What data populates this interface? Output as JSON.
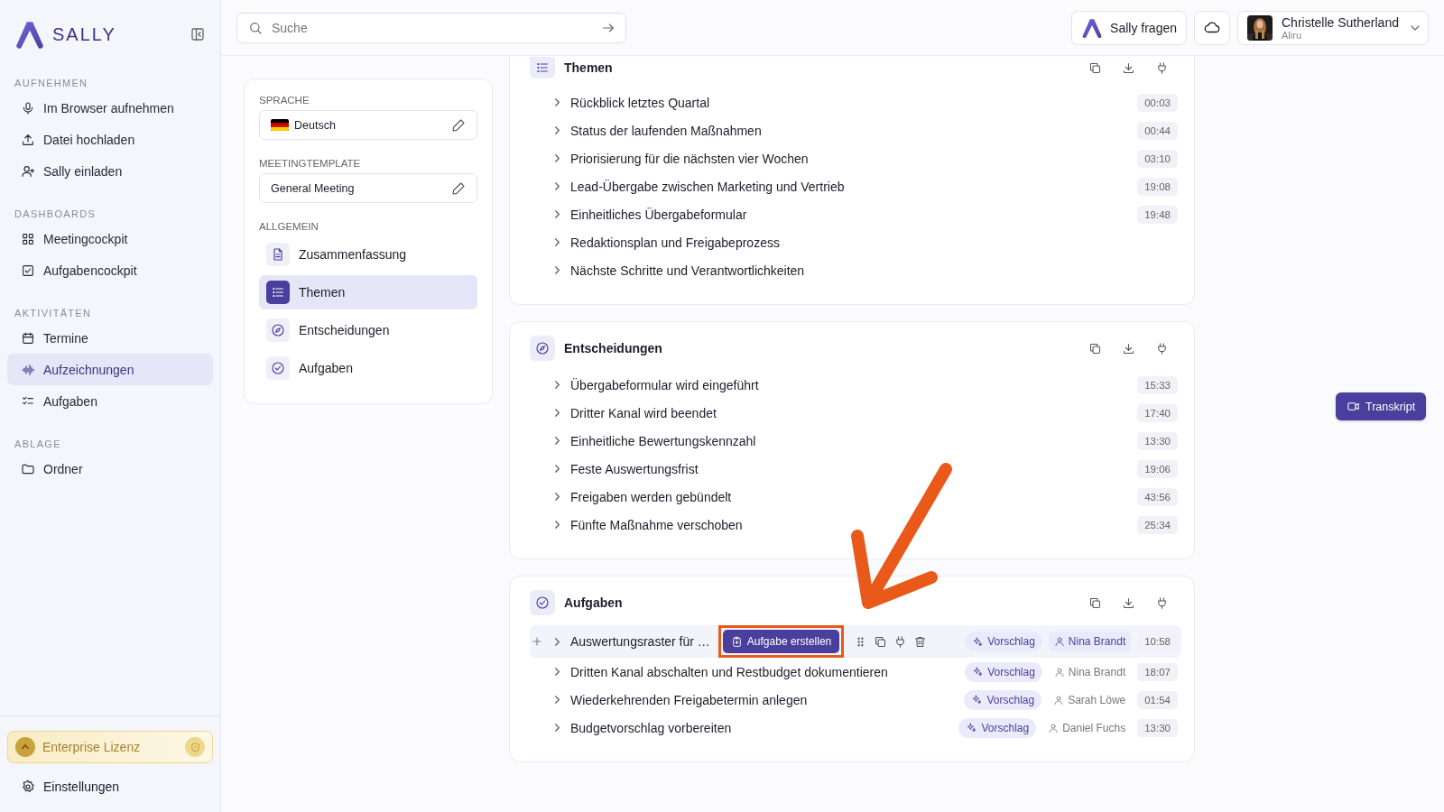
{
  "sidebar": {
    "brand": "SALLY",
    "sections": [
      {
        "title": "AUFNEHMEN",
        "items": [
          {
            "label": "Im Browser aufnehmen",
            "selected": false
          },
          {
            "label": "Datei hochladen",
            "selected": false
          },
          {
            "label": "Sally einladen",
            "selected": false
          }
        ]
      },
      {
        "title": "DASHBOARDS",
        "items": [
          {
            "label": "Meetingcockpit",
            "selected": false
          },
          {
            "label": "Aufgabencockpit",
            "selected": false
          }
        ]
      },
      {
        "title": "AKTIVITÄTEN",
        "items": [
          {
            "label": "Termine",
            "selected": false
          },
          {
            "label": "Aufzeichnungen",
            "selected": true
          },
          {
            "label": "Aufgaben",
            "selected": false
          }
        ]
      },
      {
        "title": "ABLAGE",
        "items": [
          {
            "label": "Ordner",
            "selected": false
          }
        ]
      }
    ],
    "license": "Enterprise Lizenz",
    "settings": "Einstellungen"
  },
  "topbar": {
    "search": {
      "placeholder": "Suche"
    },
    "ask_button": "Sally fragen",
    "user": {
      "name": "Christelle Sutherland",
      "org": "Aliru"
    }
  },
  "panel": {
    "language": {
      "label": "SPRACHE",
      "value": "Deutsch"
    },
    "template": {
      "label": "MEETINGTEMPLATE",
      "value": "General Meeting"
    },
    "general_label": "ALLGEMEIN",
    "items": [
      {
        "label": "Zusammenfassung",
        "selected": false
      },
      {
        "label": "Themen",
        "selected": true
      },
      {
        "label": "Entscheidungen",
        "selected": false
      },
      {
        "label": "Aufgaben",
        "selected": false
      }
    ]
  },
  "cards": [
    {
      "kind": "topics",
      "title": "Themen",
      "rows": [
        {
          "text": "Rückblick letztes Quartal",
          "time": "00:03"
        },
        {
          "text": "Status der laufenden Maßnahmen",
          "time": "00:44"
        },
        {
          "text": "Priorisierung für die nächsten vier Wochen",
          "time": "03:10"
        },
        {
          "text": "Lead-Übergabe zwischen Marketing und Vertrieb",
          "time": "19:08"
        },
        {
          "text": "Einheitliches Übergabeformular",
          "time": "19:48"
        },
        {
          "text": "Redaktionsplan und Freigabeprozess"
        },
        {
          "text": "Nächste Schritte und Verantwortlichkeiten"
        }
      ]
    },
    {
      "kind": "decisions",
      "title": "Entscheidungen",
      "rows": [
        {
          "text": "Übergabeformular wird eingeführt",
          "time": "15:33"
        },
        {
          "text": "Dritter Kanal wird beendet",
          "time": "17:40"
        },
        {
          "text": "Einheitliche Bewertungskennzahl",
          "time": "13:30"
        },
        {
          "text": "Feste Auswertungsfrist",
          "time": "19:06"
        },
        {
          "text": "Freigaben werden gebündelt",
          "time": "43:56"
        },
        {
          "text": "Fünfte Maßnahme verschoben",
          "time": "25:34"
        }
      ]
    },
    {
      "kind": "tasks",
      "title": "Aufgaben",
      "rows": [
        {
          "text": "Auswertungsraster für …",
          "selected": true,
          "action": {
            "label": "Aufgabe erstellen",
            "highlighted": true
          },
          "tag": "Vorschlag",
          "assignee": "Nina Brandt",
          "time": "10:58"
        },
        {
          "text": "Dritten Kanal abschalten und Restbudget dokumentieren",
          "selected": false,
          "tag": "Vorschlag",
          "assignee": "Nina Brandt",
          "time": "18:07"
        },
        {
          "text": "Wiederkehrenden Freigabetermin anlegen",
          "selected": false,
          "tag": "Vorschlag",
          "assignee": "Sarah Löwe",
          "time": "01:54"
        },
        {
          "text": "Budgetvorschlag vorbereiten",
          "selected": false,
          "tag": "Vorschlag",
          "assignee": "Daniel Fuchs",
          "time": "13:30"
        }
      ]
    }
  ],
  "transcript_button": "Transkript"
}
